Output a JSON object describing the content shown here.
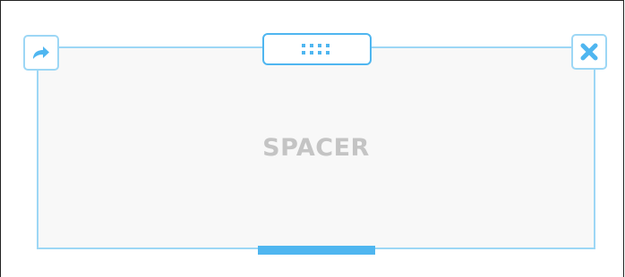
{
  "spacer": {
    "label": "SPACER"
  },
  "controls": {
    "move_icon": "share-arrow-icon",
    "drag_icon": "drag-dots-icon",
    "remove_icon": "close-icon",
    "resize_handle": "bottom-resize-handle"
  },
  "colors": {
    "accent": "#4fb6f0",
    "border": "#9dd7f5",
    "label": "#c4c4c4",
    "background": "#f8f8f8"
  }
}
